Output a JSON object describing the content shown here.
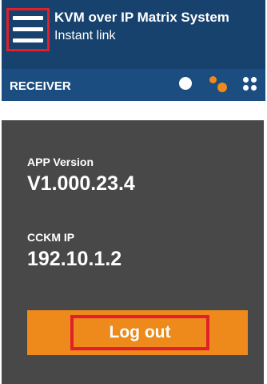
{
  "header": {
    "title": "KVM over IP Matrix System",
    "subtitle": "Instant link",
    "menu_icon": "hamburger-menu-icon",
    "section_label": "RECEIVER",
    "view_icons": [
      "single-view-icon",
      "multi-view-icon",
      "grid-view-icon"
    ]
  },
  "info": {
    "app_version_label": "APP Version",
    "app_version_value": "V1.000.23.4",
    "cckm_ip_label": "CCKM IP",
    "cckm_ip_value": "192.10.1.2"
  },
  "actions": {
    "logout_label": "Log out"
  },
  "colors": {
    "header_bg": "#17426e",
    "subbar_bg": "#1c4d80",
    "panel_bg": "#484848",
    "accent_orange": "#ee8a1c",
    "highlight_red": "#e0202a"
  }
}
